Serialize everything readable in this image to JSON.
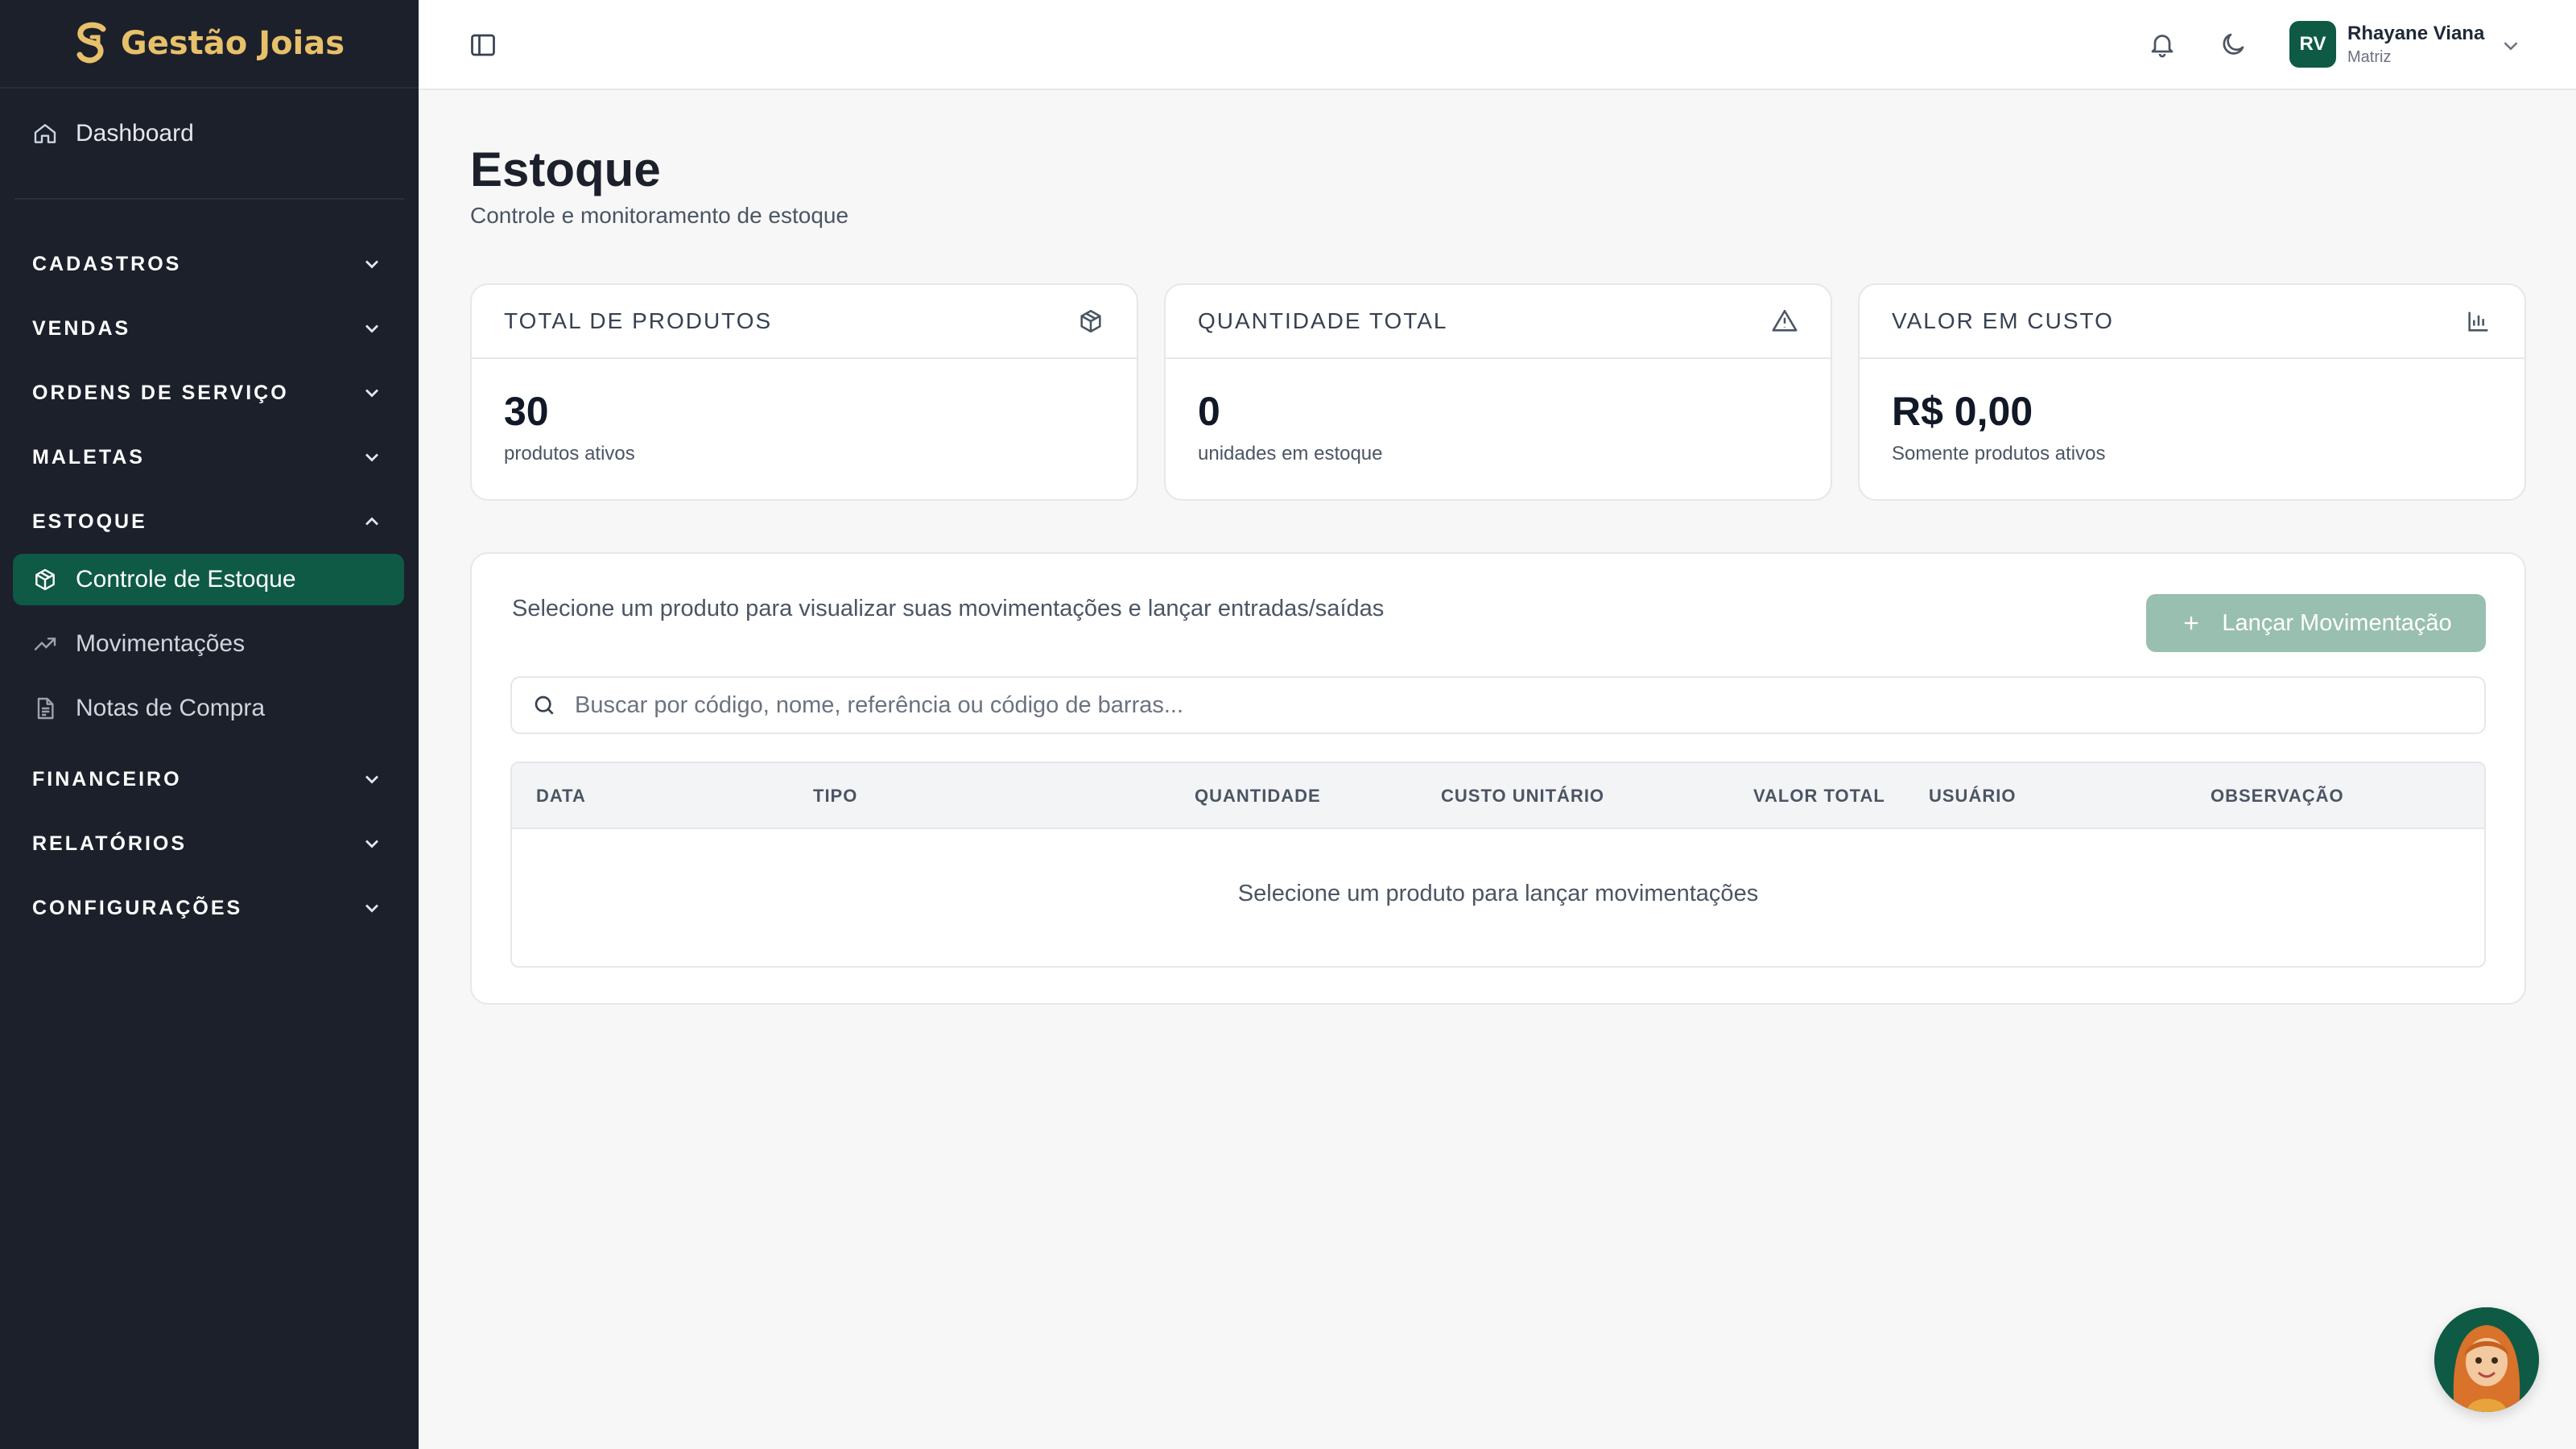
{
  "brand": {
    "name": "Gestão Joias"
  },
  "sidebar": {
    "dashboard": "Dashboard",
    "sections": {
      "cadastros": "CADASTROS",
      "vendas": "VENDAS",
      "ordens": "ORDENS DE SERVIÇO",
      "maletas": "MALETAS",
      "estoque": "ESTOQUE",
      "financeiro": "FINANCEIRO",
      "relatorios": "RELATÓRIOS",
      "configuracoes": "CONFIGURAÇÕES"
    },
    "estoque_items": {
      "controle": "Controle de Estoque",
      "movimentacoes": "Movimentações",
      "notas": "Notas de Compra"
    }
  },
  "topbar": {
    "user_initials": "RV",
    "user_name": "Rhayane Viana",
    "user_org": "Matriz"
  },
  "page": {
    "title": "Estoque",
    "subtitle": "Controle e monitoramento de estoque"
  },
  "cards": {
    "total": {
      "title": "TOTAL DE PRODUTOS",
      "value": "30",
      "sub": "produtos ativos",
      "icon": "package-icon"
    },
    "quantidade": {
      "title": "QUANTIDADE TOTAL",
      "value": "0",
      "sub": "unidades em estoque",
      "icon": "alert-triangle-icon"
    },
    "valor": {
      "title": "VALOR EM CUSTO",
      "value": "R$ 0,00",
      "sub": "Somente produtos ativos",
      "icon": "bar-chart-icon"
    }
  },
  "panel": {
    "hint": "Selecione um produto para visualizar suas movimentações e lançar entradas/saídas",
    "launch_button": "Lançar Movimentação",
    "search_placeholder": "Buscar por código, nome, referência ou código de barras...",
    "columns": {
      "data": "DATA",
      "tipo": "TIPO",
      "quantidade": "QUANTIDADE",
      "custo": "CUSTO UNITÁRIO",
      "valor": "VALOR TOTAL",
      "usuario": "USUÁRIO",
      "observacao": "OBSERVAÇÃO"
    },
    "empty_message": "Selecione um produto para lançar movimentações"
  },
  "colors": {
    "sidebar_bg": "#1c202b",
    "brand_gold": "#e7c06a",
    "accent_green": "#0e5a45",
    "button_disabled": "#99bfb1"
  }
}
